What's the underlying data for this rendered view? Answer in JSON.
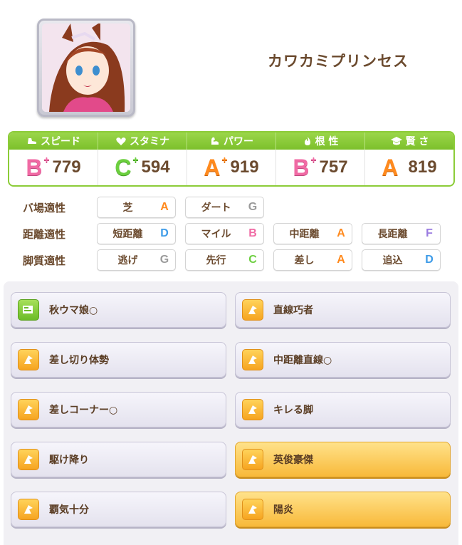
{
  "character": {
    "name": "カワカミプリンセス"
  },
  "stats": [
    {
      "label": "スピード",
      "icon": "shoe-icon",
      "rank": "B",
      "plus": "+",
      "value": "779",
      "cls": "rB"
    },
    {
      "label": "スタミナ",
      "icon": "heart-icon",
      "rank": "C",
      "plus": "+",
      "value": "594",
      "cls": "rC"
    },
    {
      "label": "パワー",
      "icon": "muscle-icon",
      "rank": "A",
      "plus": "+",
      "value": "919",
      "cls": "rA"
    },
    {
      "label": "根 性",
      "icon": "flame-icon",
      "rank": "B",
      "plus": "+",
      "value": "757",
      "cls": "rB"
    },
    {
      "label": "賢 さ",
      "icon": "grad-cap-icon",
      "rank": "A",
      "plus": "",
      "value": "819",
      "cls": "rA"
    }
  ],
  "aptitudes": {
    "track": {
      "label": "バ場適性",
      "items": [
        {
          "name": "芝",
          "grade": "A"
        },
        {
          "name": "ダート",
          "grade": "G"
        }
      ]
    },
    "distance": {
      "label": "距離適性",
      "items": [
        {
          "name": "短距離",
          "grade": "D"
        },
        {
          "name": "マイル",
          "grade": "B"
        },
        {
          "name": "中距離",
          "grade": "A"
        },
        {
          "name": "長距離",
          "grade": "F"
        }
      ]
    },
    "style": {
      "label": "脚質適性",
      "items": [
        {
          "name": "逃げ",
          "grade": "G"
        },
        {
          "name": "先行",
          "grade": "C"
        },
        {
          "name": "差し",
          "grade": "A"
        },
        {
          "name": "追込",
          "grade": "D"
        }
      ]
    }
  },
  "skills": [
    {
      "name": "秋ウマ娘○",
      "icon": "green"
    },
    {
      "name": "直線巧者",
      "icon": "yellow"
    },
    {
      "name": "差し切り体勢",
      "icon": "yellow"
    },
    {
      "name": "中距離直線○",
      "icon": "yellow"
    },
    {
      "name": "差しコーナー○",
      "icon": "yellow"
    },
    {
      "name": "キレる脚",
      "icon": "yellow"
    },
    {
      "name": "駆け降り",
      "icon": "yellow"
    },
    {
      "name": "英俊豪傑",
      "icon": "yellow",
      "gold": true
    },
    {
      "name": "覇気十分",
      "icon": "yellow"
    },
    {
      "name": "陽炎",
      "icon": "yellow",
      "gold": true
    }
  ]
}
